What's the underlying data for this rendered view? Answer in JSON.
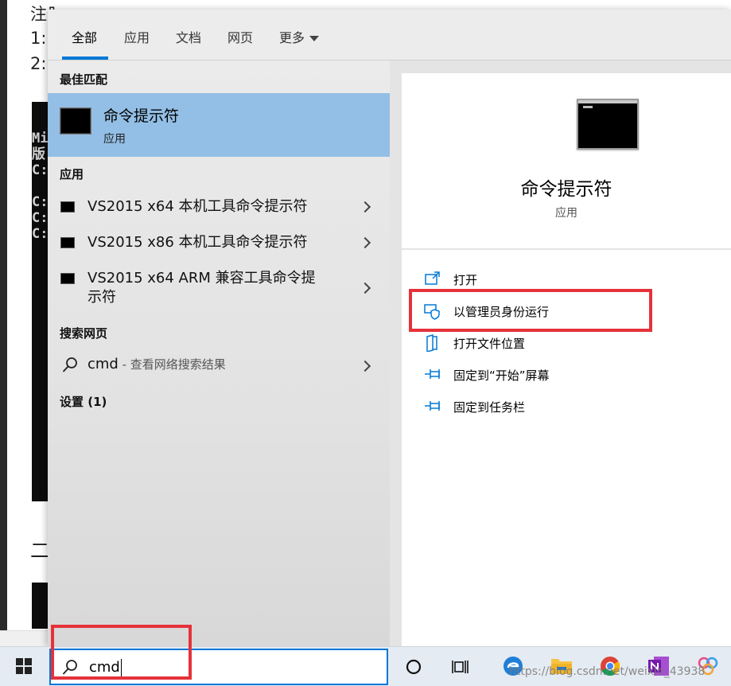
{
  "background_doc": {
    "lines": [
      "注册命令",
      "1:",
      "2:"
    ],
    "console_lines": [
      "Mi",
      "版",
      "",
      "C:",
      "C:",
      "",
      "C:",
      "C:"
    ],
    "bottom_heading": "二"
  },
  "tabs": [
    {
      "label": "全部",
      "active": true
    },
    {
      "label": "应用"
    },
    {
      "label": "文档"
    },
    {
      "label": "网页"
    },
    {
      "label": "更多"
    }
  ],
  "best_match": {
    "heading": "最佳匹配",
    "title": "命令提示符",
    "subtitle": "应用"
  },
  "apps": {
    "heading": "应用",
    "items": [
      {
        "label": "VS2015 x64 本机工具命令提示符"
      },
      {
        "label": "VS2015 x86 本机工具命令提示符"
      },
      {
        "label": "VS2015 x64 ARM 兼容工具命令提示符"
      }
    ]
  },
  "web": {
    "heading": "搜索网页",
    "query": "cmd",
    "suffix": " - 查看网络搜索结果"
  },
  "settings_heading": "设置 (1)",
  "detail": {
    "title": "命令提示符",
    "subtitle": "应用",
    "actions": [
      {
        "label": "打开",
        "icon": "open-icon"
      },
      {
        "label": "以管理员身份运行",
        "icon": "shield-icon"
      },
      {
        "label": "打开文件位置",
        "icon": "folder-location-icon"
      },
      {
        "label": "固定到“开始”屏幕",
        "icon": "pin-icon"
      },
      {
        "label": "固定到任务栏",
        "icon": "pin-icon"
      }
    ]
  },
  "taskbar": {
    "search_value": "cmd",
    "watermark": "https://blog.csdn.net/weixin_43938"
  },
  "colors": {
    "accent": "#0078d7",
    "highlight": "#93bfe6",
    "annotation": "#e5323a"
  }
}
